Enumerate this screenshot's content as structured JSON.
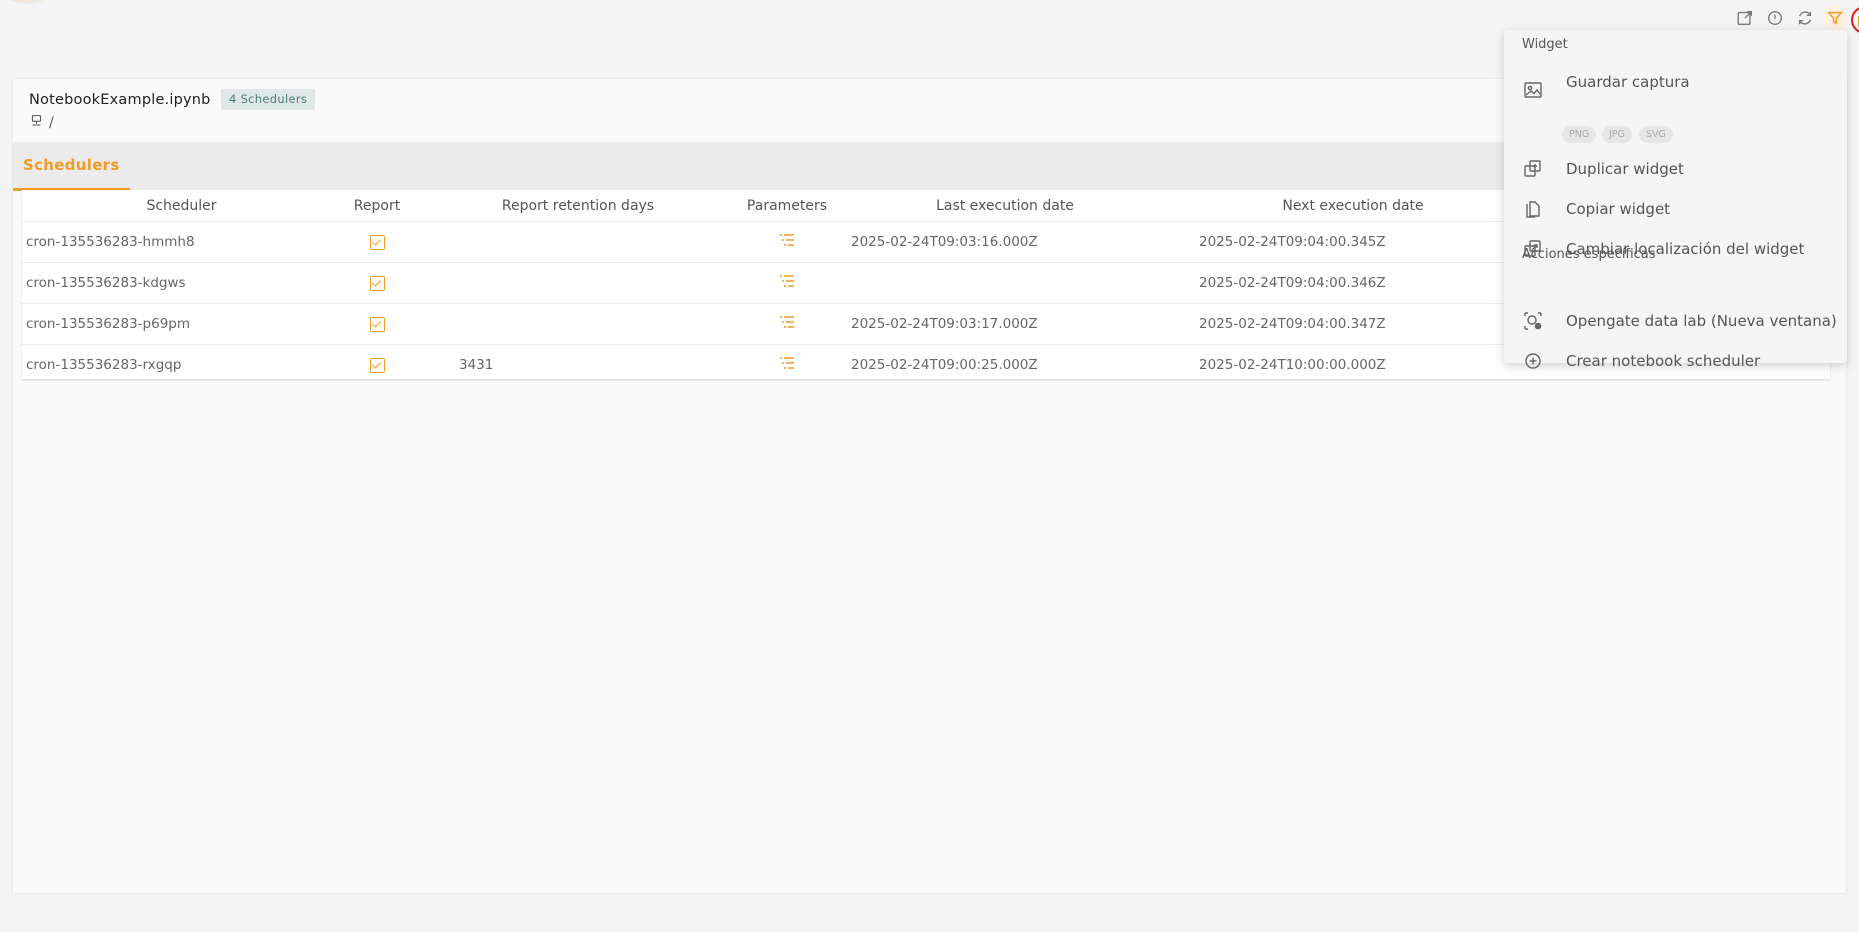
{
  "toolbar": {
    "icons": [
      "open-external-icon",
      "comment-icon",
      "refresh-icon",
      "filter-icon",
      "widget-menu-icon"
    ]
  },
  "widget": {
    "title": "NotebookExample.ipynb",
    "badge": "4 Schedulers",
    "breadcrumb": "/",
    "tabs": [
      {
        "label": "Schedulers"
      }
    ]
  },
  "table": {
    "headers": [
      "Scheduler",
      "Report",
      "Report retention days",
      "Parameters",
      "Last execution date",
      "Next execution date"
    ],
    "rows": [
      {
        "scheduler": "cron-135536283-hmmh8",
        "report": true,
        "retention": "",
        "last": "2025-02-24T09:03:16.000Z",
        "next": "2025-02-24T09:04:00.345Z"
      },
      {
        "scheduler": "cron-135536283-kdgws",
        "report": true,
        "retention": "",
        "last": "",
        "next": "2025-02-24T09:04:00.346Z"
      },
      {
        "scheduler": "cron-135536283-p69pm",
        "report": true,
        "retention": "",
        "last": "2025-02-24T09:03:17.000Z",
        "next": "2025-02-24T09:04:00.347Z"
      },
      {
        "scheduler": "cron-135536283-rxgqp",
        "report": true,
        "retention": "3431",
        "last": "2025-02-24T09:00:25.000Z",
        "next": "2025-02-24T10:00:00.000Z"
      }
    ]
  },
  "menu": {
    "section_widget": "Widget",
    "save_capture": "Guardar captura",
    "formats": [
      "PNG",
      "JPG",
      "SVG"
    ],
    "duplicate": "Duplicar widget",
    "copy": "Copiar widget",
    "relocate": "Cambiar localización del widget",
    "section_specific": "Acciones específicas",
    "open_lab": "Opengate data lab (Nueva ventana)",
    "create_scheduler": "Crear notebook scheduler"
  },
  "colors": {
    "accent": "#f29b25",
    "badge_bg": "#dfe8e6",
    "badge_text": "#4e7f72",
    "highlight_ring": "#e01919"
  }
}
